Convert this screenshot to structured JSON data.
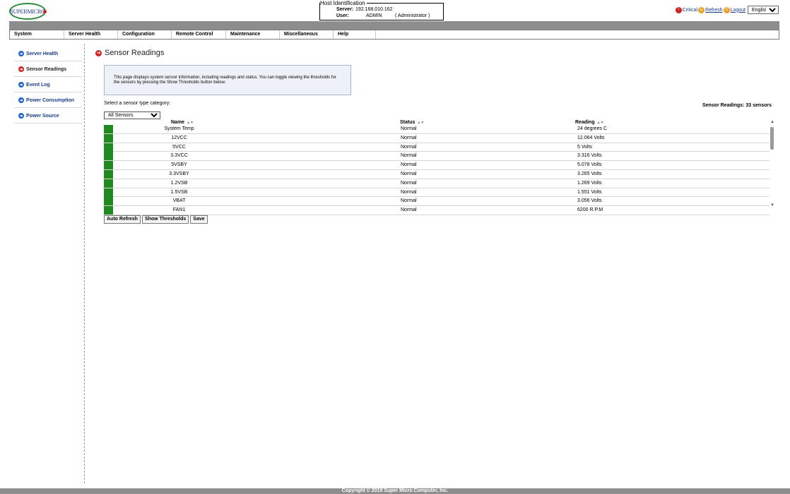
{
  "header": {
    "logo_text": "SUPERMICRO",
    "host_title": "Host Identification",
    "server_label": "Server:",
    "server_value": "192.168.010.162",
    "user_label": "User:",
    "user_value": "ADMIN",
    "user_role": "( Administrator )",
    "critical_label": "Critical",
    "refresh_label": "Refresh",
    "logout_label": "Logout",
    "language": "English"
  },
  "menu": [
    "System",
    "Server Health",
    "Configuration",
    "Remote Control",
    "Maintenance",
    "Miscellaneous",
    "Help"
  ],
  "sidebar": {
    "items": [
      {
        "label": "Server Health",
        "active": false
      },
      {
        "label": "Sensor Readings",
        "active": true
      },
      {
        "label": "Event Log",
        "active": false
      },
      {
        "label": "Power Consumption",
        "active": false
      },
      {
        "label": "Power Source",
        "active": false
      }
    ]
  },
  "main": {
    "title": "Sensor Readings",
    "info_text": "This page displays system sensor information, including readings and status. You can toggle viewing the thresholds for the sensors by pressing the Show Thresholds button below.",
    "select_label": "Select a sensor type category:",
    "category_selected": "All Sensors",
    "sensor_count": "Sensor Readings: 33 sensors",
    "table": {
      "headers": {
        "name": "Name",
        "status": "Status",
        "reading": "Reading"
      },
      "rows": [
        {
          "name": "System Temp",
          "status": "Normal",
          "reading": "24 degrees C"
        },
        {
          "name": "12VCC",
          "status": "Normal",
          "reading": "12.064 Volts"
        },
        {
          "name": "5VCC",
          "status": "Normal",
          "reading": "5 Volts"
        },
        {
          "name": "3.3VCC",
          "status": "Normal",
          "reading": "3.316 Volts"
        },
        {
          "name": "5VSBY",
          "status": "Normal",
          "reading": "5.078 Volts"
        },
        {
          "name": "3.3VSBY",
          "status": "Normal",
          "reading": "3.265 Volts"
        },
        {
          "name": "1.2VSB",
          "status": "Normal",
          "reading": "1.269 Volts"
        },
        {
          "name": "1.5VSB",
          "status": "Normal",
          "reading": "1.551 Volts"
        },
        {
          "name": "VBAT",
          "status": "Normal",
          "reading": "3.056 Volts"
        },
        {
          "name": "FAN1",
          "status": "Normal",
          "reading": "6200 R.P.M"
        }
      ],
      "status_color": "#1f8a1f"
    },
    "buttons": {
      "auto_refresh": "Auto Refresh",
      "show_thresholds": "Show Thresholds",
      "save": "Save"
    }
  },
  "footer": {
    "copyright": "Copyright © 2019 Super Micro Computer, Inc."
  }
}
